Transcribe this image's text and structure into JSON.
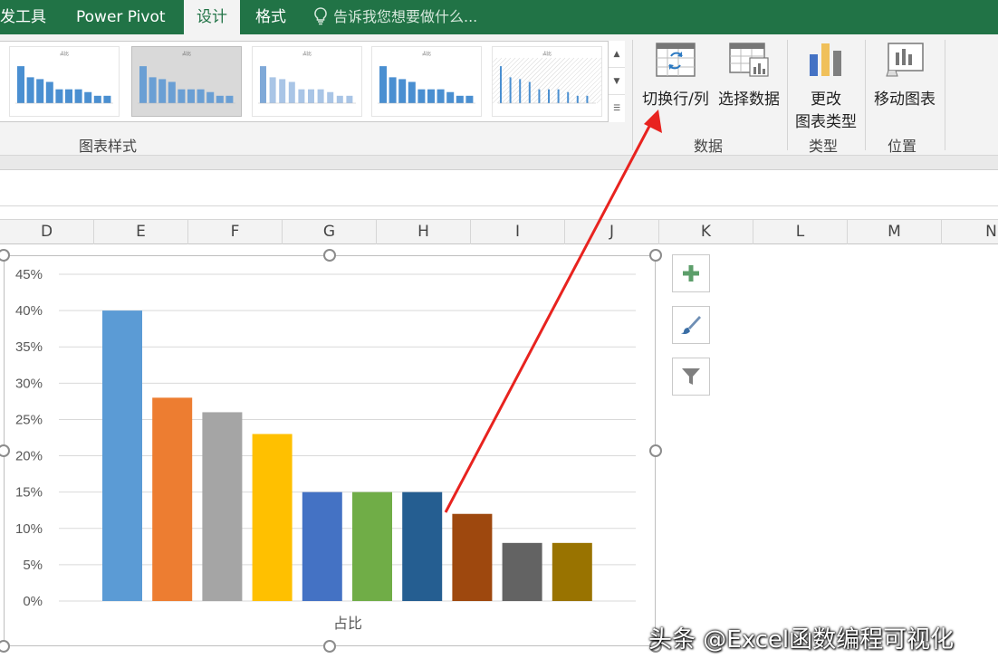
{
  "ribbon": {
    "tabs": [
      {
        "label": "发工具",
        "active": false
      },
      {
        "label": "Power Pivot",
        "active": false
      },
      {
        "label": "设计",
        "active": true
      },
      {
        "label": "格式",
        "active": false
      }
    ],
    "tell_me": "告诉我您想要做什么...",
    "groups": {
      "chart_styles": "图表样式",
      "data": "数据",
      "type": "类型",
      "location": "位置"
    },
    "buttons": {
      "switch_row_col": "切换行/列",
      "select_data": "选择数据",
      "change_type_line1": "更改",
      "change_type_line2": "图表类型",
      "move_chart": "移动图表"
    },
    "gallery_thumb_title": "占比"
  },
  "columns": [
    "D",
    "E",
    "F",
    "G",
    "H",
    "I",
    "J",
    "K",
    "L",
    "M",
    "N"
  ],
  "chart_data": {
    "type": "bar",
    "xlabel": "占比",
    "ylabel": "",
    "ylim": [
      0,
      45
    ],
    "ytick_step": 5,
    "yticks": [
      "0%",
      "5%",
      "10%",
      "15%",
      "20%",
      "25%",
      "30%",
      "35%",
      "40%",
      "45%"
    ],
    "grid": true,
    "values": [
      40,
      28,
      26,
      23,
      15,
      15,
      15,
      12,
      8,
      8
    ],
    "colors": [
      "#5B9BD5",
      "#ED7D31",
      "#A5A5A5",
      "#FFC000",
      "#4472C4",
      "#70AD47",
      "#255E91",
      "#9E480E",
      "#636363",
      "#997300"
    ]
  },
  "colors": {
    "ribbon_green": "#217346",
    "arrow_red": "#E8231F"
  },
  "watermark": "头条 @Excel函数编程可视化"
}
